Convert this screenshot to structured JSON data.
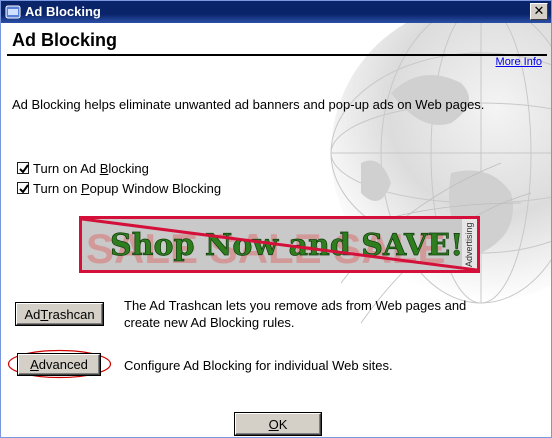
{
  "window": {
    "title": "Ad Blocking",
    "close_glyph": "✕"
  },
  "header": {
    "page_title": "Ad Blocking",
    "more_info_link": "More Info"
  },
  "description": "Ad Blocking helps eliminate unwanted ad banners and pop-up ads on Web pages.",
  "options": [
    {
      "label_before": "Turn on Ad ",
      "accel": "B",
      "label_after": "locking",
      "checked": true
    },
    {
      "label_before": "Turn on ",
      "accel": "P",
      "label_after": "opup Window Blocking",
      "checked": true
    }
  ],
  "banner": {
    "headline": "Shop Now and SAVE!",
    "background_text": "SALE SALE SALE",
    "side_label": "Advertising",
    "border_color": "#d4103a",
    "headline_color": "#2e7d1f"
  },
  "trashcan": {
    "button_before": "Ad ",
    "button_accel": "T",
    "button_after": "rashcan",
    "desc_line1": "The Ad Trashcan lets you remove ads from Web pages and",
    "desc_line2": "create new Ad Blocking rules."
  },
  "advanced": {
    "button_accel": "A",
    "button_after": "dvanced",
    "description": "Configure Ad Blocking for individual Web sites.",
    "highlight_color": "#cc0000"
  },
  "footer": {
    "ok_accel": "O",
    "ok_after": "K"
  },
  "colors": {
    "titlebar": "#0a246a",
    "link": "#0000ee",
    "button_face": "#d4d0c8"
  }
}
